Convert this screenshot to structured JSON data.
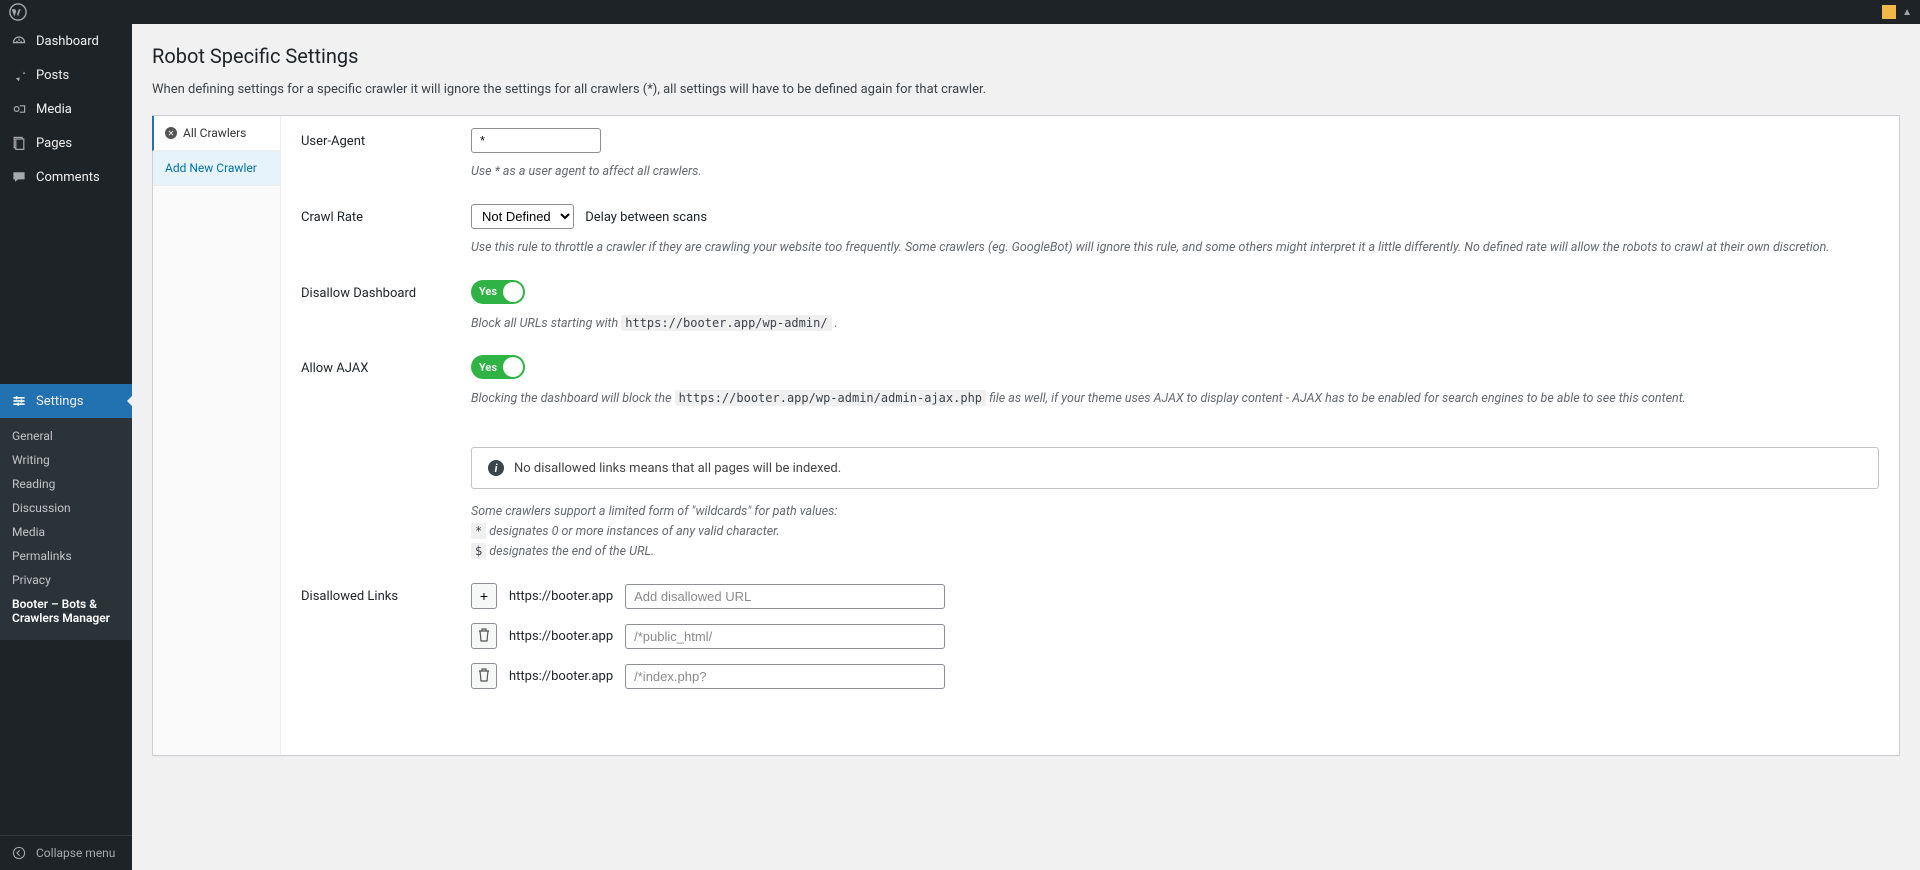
{
  "adminbar": {
    "wp": "WordPress"
  },
  "sidebar": {
    "items": [
      {
        "label": "Dashboard",
        "icon": "dashboard"
      },
      {
        "label": "Posts",
        "icon": "pin"
      },
      {
        "label": "Media",
        "icon": "media"
      },
      {
        "label": "Pages",
        "icon": "pages"
      },
      {
        "label": "Comments",
        "icon": "comments"
      },
      {
        "label": "Settings",
        "icon": "settings",
        "active": true
      }
    ],
    "submenu": [
      {
        "label": "General"
      },
      {
        "label": "Writing"
      },
      {
        "label": "Reading"
      },
      {
        "label": "Discussion"
      },
      {
        "label": "Media"
      },
      {
        "label": "Permalinks"
      },
      {
        "label": "Privacy"
      },
      {
        "label": "Booter – Bots & Crawlers Manager",
        "current": true
      }
    ],
    "collapse": "Collapse menu"
  },
  "page": {
    "title": "Robot Specific Settings",
    "desc": "When defining settings for a specific crawler it will ignore the settings for all crawlers (*), all settings will have to be defined again for that crawler."
  },
  "tabs": {
    "all": "All Crawlers",
    "add": "Add New Crawler"
  },
  "form": {
    "userAgent": {
      "label": "User-Agent",
      "value": "*",
      "hint": "Use * as a user agent to affect all crawlers."
    },
    "crawlRate": {
      "label": "Crawl Rate",
      "selected": "Not Defined",
      "inline": "Delay between scans",
      "hint": "Use this rule to throttle a crawler if they are crawling your website too frequently. Some crawlers (eg. GoogleBot) will ignore this rule, and some others might interpret it a little differently. No defined rate will allow the robots to crawl at their own discretion."
    },
    "disallowDashboard": {
      "label": "Disallow Dashboard",
      "toggle": "Yes",
      "hint_pre": "Block all URLs starting with ",
      "hint_code": "https://booter.app/wp-admin/",
      "hint_post": " ."
    },
    "allowAjax": {
      "label": "Allow AJAX",
      "toggle": "Yes",
      "hint_pre": "Blocking the dashboard will block the ",
      "hint_code": "https://booter.app/wp-admin/admin-ajax.php",
      "hint_post": " file as well, if your theme uses AJAX to display content - AJAX has to be enabled for search engines to be able to see this content."
    },
    "infoBox": "No disallowed links means that all pages will be indexed.",
    "wildcards": {
      "intro": "Some crawlers support a limited form of \"wildcards\" for path values:",
      "star_code": "*",
      "star_text": " designates 0 or more instances of any valid character.",
      "dollar_code": "$",
      "dollar_text": " designates the end of the URL."
    },
    "disallowedLinks": {
      "label": "Disallowed Links",
      "prefix": "https://booter.app",
      "rows": [
        {
          "action": "add",
          "placeholder": "Add disallowed URL",
          "value": ""
        },
        {
          "action": "delete",
          "placeholder": "/*public_html/",
          "value": ""
        },
        {
          "action": "delete",
          "placeholder": "/*index.php?",
          "value": ""
        }
      ]
    }
  }
}
